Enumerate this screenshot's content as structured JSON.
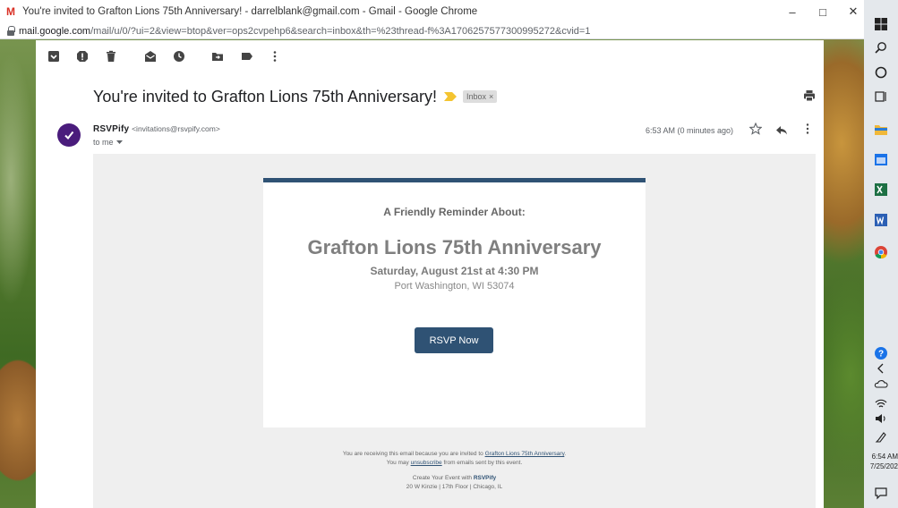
{
  "window": {
    "title": "You're invited to Grafton Lions 75th Anniversary! - darrelblank@gmail.com - Gmail - Google Chrome",
    "minimize": "–",
    "maximize": "□",
    "close": "✕"
  },
  "address": {
    "host": "mail.google.com",
    "path": "/mail/u/0/?ui=2&view=btop&ver=ops2cvpehp6&search=inbox&th=%23thread-f%3A1706257577300995272&cvid=1"
  },
  "email": {
    "subject": "You're invited to Grafton Lions 75th Anniversary!",
    "label": "Inbox",
    "label_close": "×",
    "sender_name": "RSVPify",
    "sender_email": "<invitations@rsvpify.com>",
    "to": "to me",
    "timestamp": "6:53 AM (0 minutes ago)"
  },
  "card": {
    "reminder": "A Friendly Reminder About:",
    "event_title": "Grafton Lions 75th Anniversary",
    "event_date": "Saturday, August 21st at 4:30 PM",
    "event_location": "Port Washington, WI 53074",
    "rsvp_button": "RSVP Now"
  },
  "footer": {
    "line1_pre": "You are receiving this email because you are invited to ",
    "line1_link": "Grafton Lions 75th Anniversary",
    "line1_post": ".",
    "line2_pre": "You may ",
    "line2_link": "unsubscribe",
    "line2_post": " from emails sent by this event.",
    "line3_pre": "Create Your Event with ",
    "line3_brand": "RSVPify",
    "line4": "20 W Kinzie | 17th Floor | Chicago, IL"
  },
  "taskbar": {
    "time": "6:54 AM",
    "date": "7/25/202"
  },
  "colors": {
    "accent": "#2f5274",
    "avatar": "#4a1c7c",
    "gmail_red": "#d93025"
  }
}
